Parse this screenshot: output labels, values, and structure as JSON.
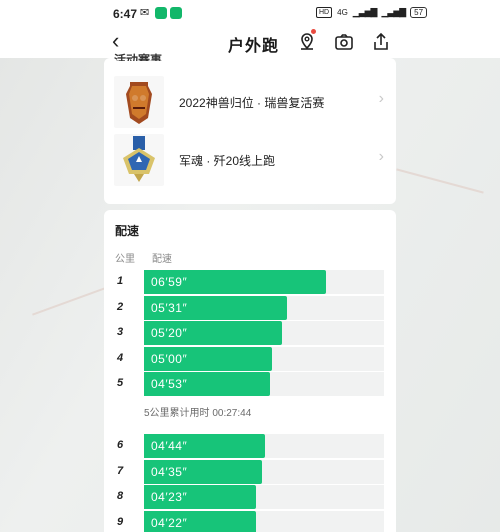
{
  "status_bar": {
    "time": "6:47",
    "network": "4G",
    "battery": "57"
  },
  "nav": {
    "title": "户外跑"
  },
  "events": {
    "section_title": "活动赛事",
    "items": [
      {
        "name": "2022神兽归位 · 瑞兽复活赛"
      },
      {
        "name": "军魂 · 歼20线上跑"
      }
    ]
  },
  "pace": {
    "title": "配速",
    "col_km": "公里",
    "col_pace": "配速",
    "rows": [
      {
        "km": "1",
        "pace": "06′59″",
        "ratio": 0.76
      },
      {
        "km": "2",
        "pace": "05′31″",
        "ratio": 0.595
      },
      {
        "km": "3",
        "pace": "05′20″",
        "ratio": 0.575
      },
      {
        "km": "4",
        "pace": "05′00″",
        "ratio": 0.535
      },
      {
        "km": "5",
        "pace": "04′53″",
        "ratio": 0.525
      }
    ],
    "cumulative": "5公里累计用时 00:27:44",
    "rows2": [
      {
        "km": "6",
        "pace": "04′44″",
        "ratio": 0.505
      },
      {
        "km": "7",
        "pace": "04′35″",
        "ratio": 0.49
      },
      {
        "km": "8",
        "pace": "04′23″",
        "ratio": 0.465
      },
      {
        "km": "9",
        "pace": "04′22″",
        "ratio": 0.465
      }
    ]
  },
  "colors": {
    "accent": "#17c479",
    "track": "#f1f2f2",
    "badge_dot": "#e94a3f"
  }
}
